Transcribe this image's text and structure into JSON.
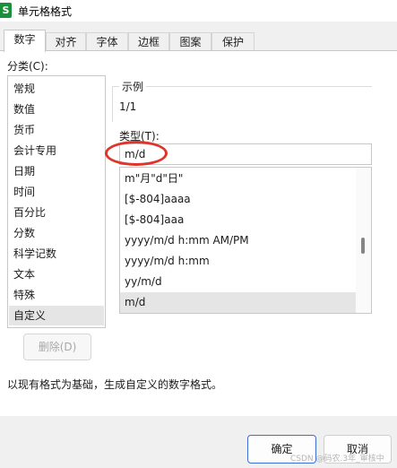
{
  "window": {
    "title": "单元格格式",
    "icon": "S"
  },
  "tabs": [
    {
      "label": "数字",
      "active": true
    },
    {
      "label": "对齐"
    },
    {
      "label": "字体"
    },
    {
      "label": "边框"
    },
    {
      "label": "图案"
    },
    {
      "label": "保护"
    }
  ],
  "category": {
    "label": "分类(C):",
    "items": [
      "常规",
      "数值",
      "货币",
      "会计专用",
      "日期",
      "时间",
      "百分比",
      "分数",
      "科学记数",
      "文本",
      "特殊",
      "自定义"
    ],
    "selected": "自定义"
  },
  "sample": {
    "label": "示例",
    "value": "1/1"
  },
  "type": {
    "label": "类型(T):",
    "value": "m/d",
    "items": [
      "m\"月\"d\"日\"",
      "[$-804]aaaa",
      "[$-804]aaa",
      "yyyy/m/d h:mm AM/PM",
      "yyyy/m/d h:mm",
      "yy/m/d",
      "m/d"
    ],
    "selected": "m/d"
  },
  "buttons": {
    "delete": "删除(D)",
    "ok": "确定",
    "cancel": "取消"
  },
  "hint": "以现有格式为基础，生成自定义的数字格式。",
  "watermark": "CSDN @码农.3年_审核中",
  "colors": {
    "highlight_circle": "#e0342a",
    "ok_border": "#3d6ed6",
    "app_icon": "#1a8f3c"
  }
}
